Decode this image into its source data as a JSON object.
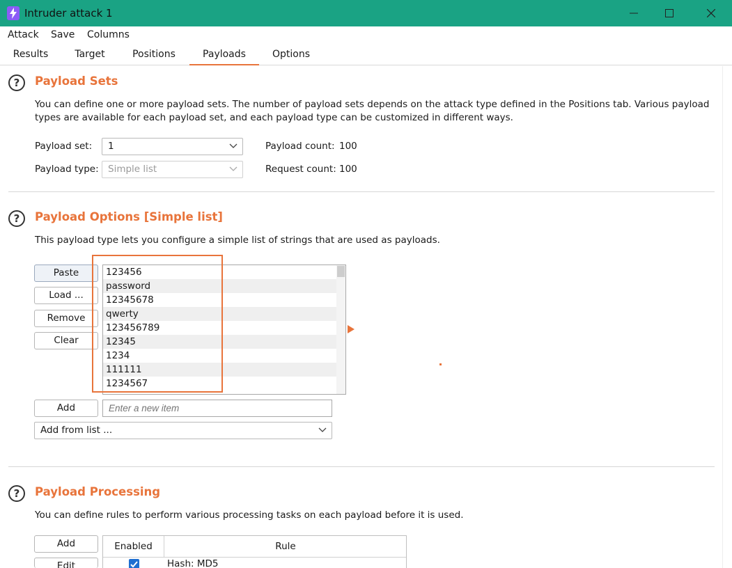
{
  "window": {
    "title": "Intruder attack 1",
    "controls": {
      "minimize": "minimize-icon",
      "maximize": "maximize-icon",
      "close": "close-icon"
    }
  },
  "menu": [
    "Attack",
    "Save",
    "Columns"
  ],
  "tabs": [
    {
      "label": "Results"
    },
    {
      "label": "Target"
    },
    {
      "label": "Positions"
    },
    {
      "label": "Payloads",
      "active": true
    },
    {
      "label": "Options"
    }
  ],
  "payload_sets": {
    "title": "Payload Sets",
    "description_line1": "You can define one or more payload sets. The number of payload sets depends on the attack type defined in the Positions tab. Various payload",
    "description_line2": "types are available for each payload set, and each payload type can be customized in different ways.",
    "set_label": "Payload set:",
    "set_value": "1",
    "type_label": "Payload type:",
    "type_value": "Simple list",
    "payload_count_label": "Payload count:",
    "payload_count": "100",
    "request_count_label": "Request count:",
    "request_count": "100"
  },
  "payload_options": {
    "title": "Payload Options [Simple list]",
    "description": "This payload type lets you configure a simple list of strings that are used as payloads.",
    "buttons": {
      "paste": "Paste",
      "load": "Load ...",
      "remove": "Remove",
      "clear": "Clear",
      "add": "Add"
    },
    "items": [
      "123456",
      "password",
      "12345678",
      "qwerty",
      "123456789",
      "12345",
      "1234",
      "111111",
      "1234567"
    ],
    "new_item_placeholder": "Enter a new item",
    "add_from_list": "Add from list ..."
  },
  "payload_processing": {
    "title": "Payload Processing",
    "description": "You can define rules to perform various processing tasks on each payload before it is used.",
    "buttons": {
      "add": "Add",
      "edit": "Edit"
    },
    "columns": {
      "enabled": "Enabled",
      "rule": "Rule"
    },
    "rows": [
      {
        "enabled": true,
        "rule": "Hash: MD5"
      }
    ]
  },
  "colors": {
    "accent": "#e8743b",
    "titlebar": "#1aa384",
    "checkbox": "#1f6fd1"
  }
}
